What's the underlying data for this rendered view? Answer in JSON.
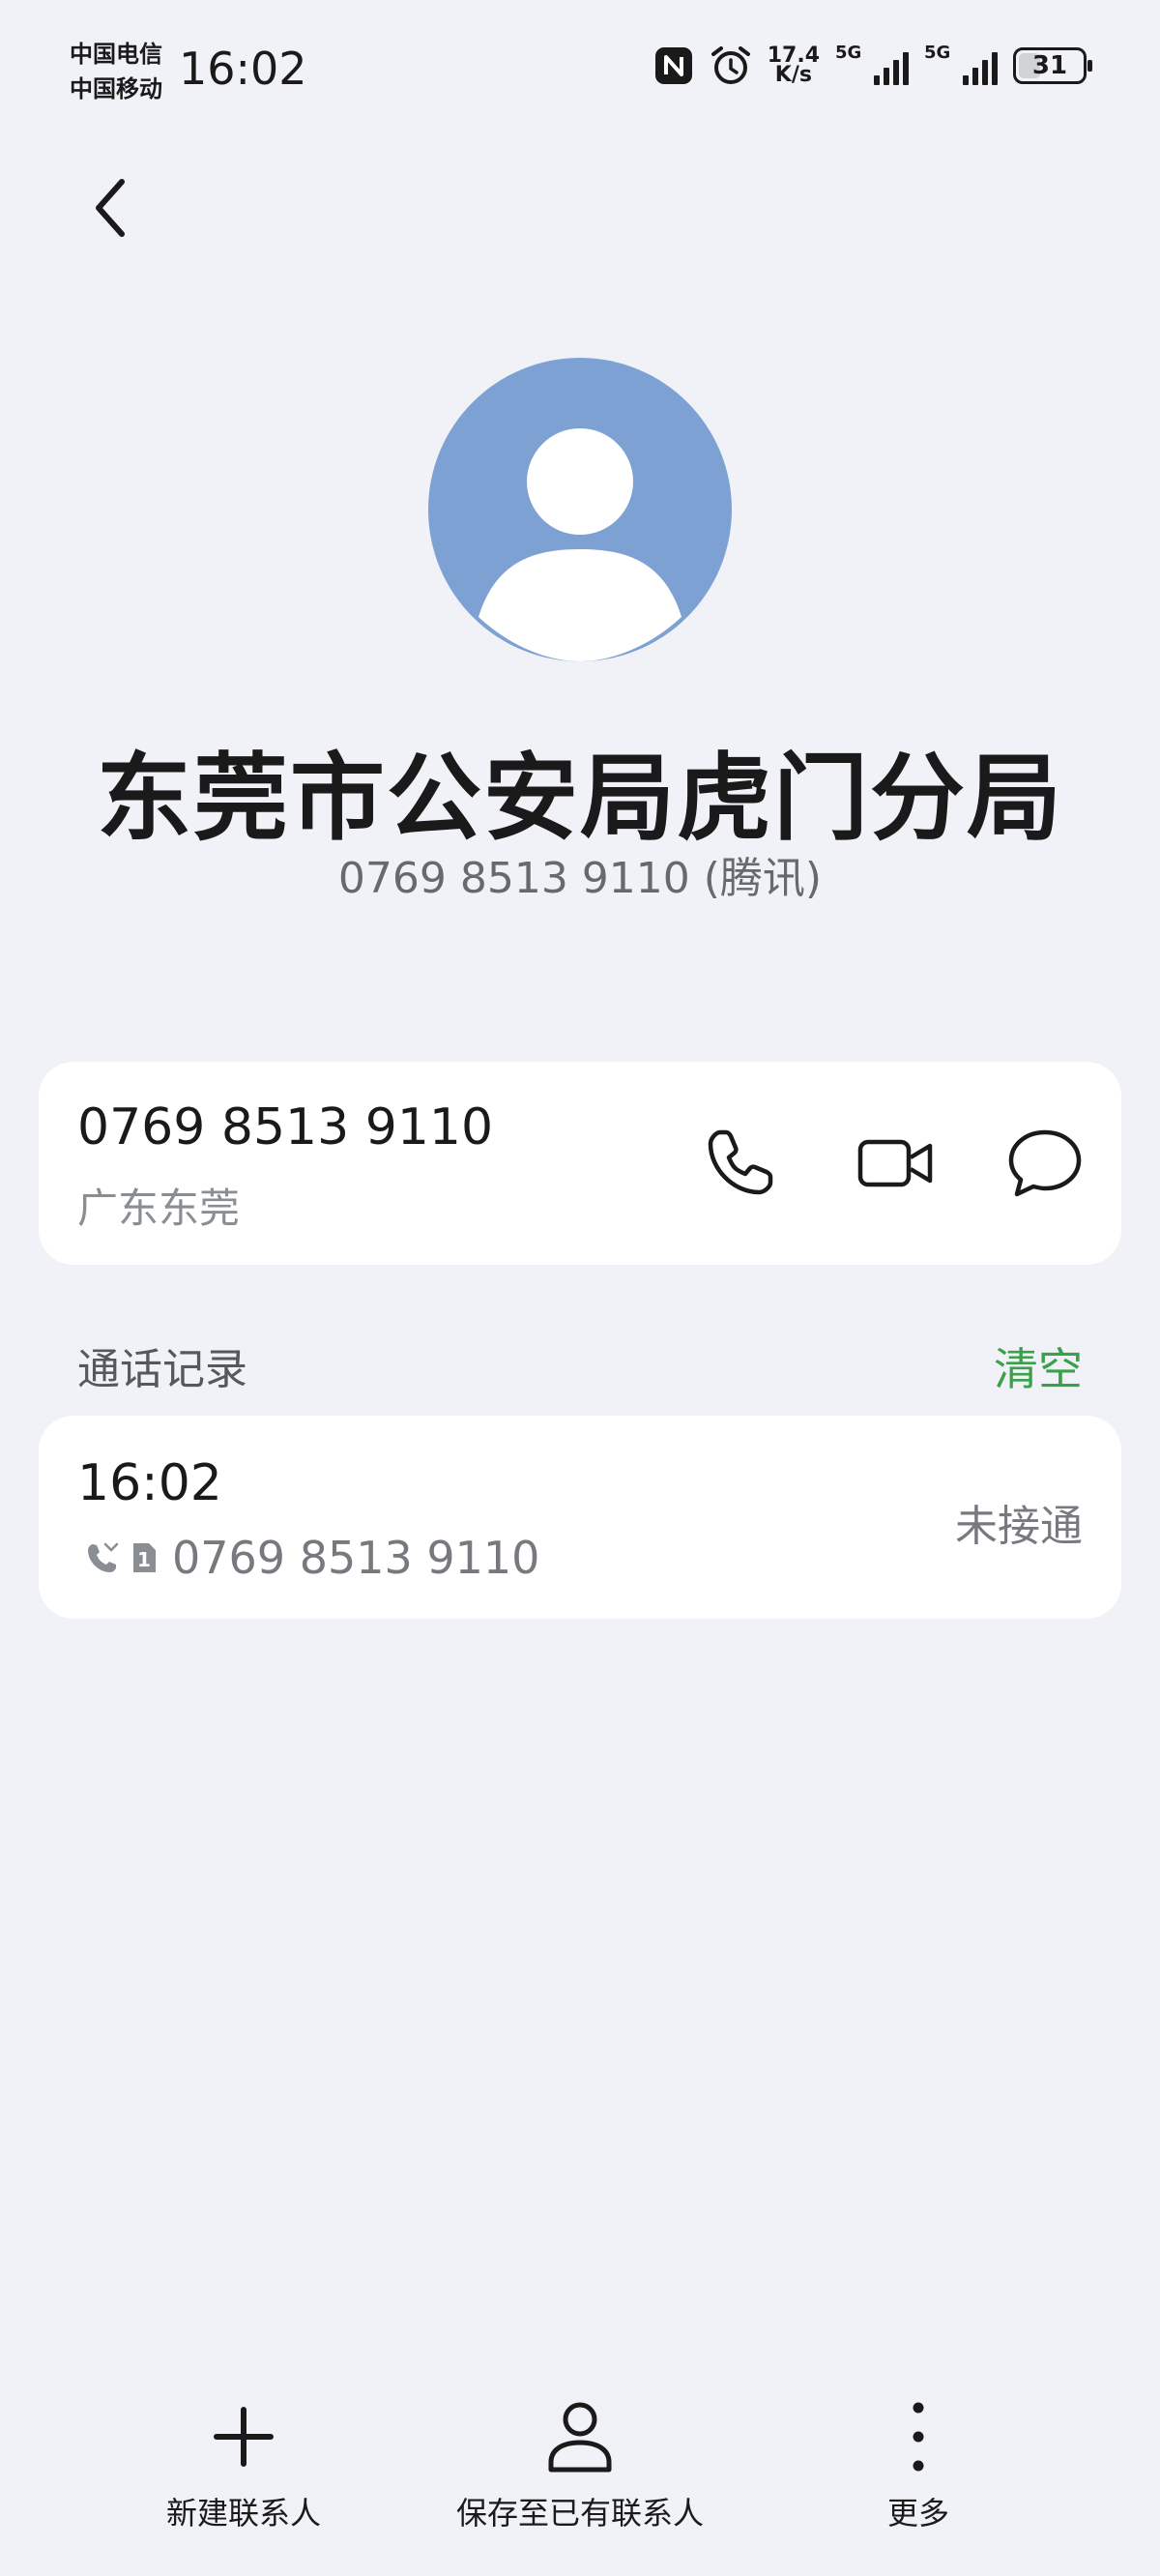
{
  "status_bar": {
    "carrier_1": "中国电信",
    "carrier_2": "中国移动",
    "time": "16:02",
    "net_speed_value": "17.4",
    "net_speed_unit": "K/s",
    "signal_1_tag": "5G",
    "signal_2_tag": "5G",
    "battery": "31"
  },
  "contact": {
    "name": "东莞市公安局虎门分局",
    "subtitle": "0769 8513 9110 (腾讯)"
  },
  "phone_card": {
    "number": "0769 8513 9110",
    "location": "广东东莞",
    "actions": [
      "phone-call",
      "video-call",
      "message"
    ]
  },
  "call_log": {
    "title": "通话记录",
    "clear_label": "清空",
    "entries": [
      {
        "time": "16:02",
        "sim": "1",
        "number": "0769 8513 9110",
        "status": "未接通"
      }
    ]
  },
  "bottom_bar": {
    "new_contact": "新建联系人",
    "save_existing": "保存至已有联系人",
    "more": "更多"
  },
  "colors": {
    "background": "#f0f2f7",
    "avatar": "#7da1d3",
    "accent_green": "#3aa14a"
  }
}
